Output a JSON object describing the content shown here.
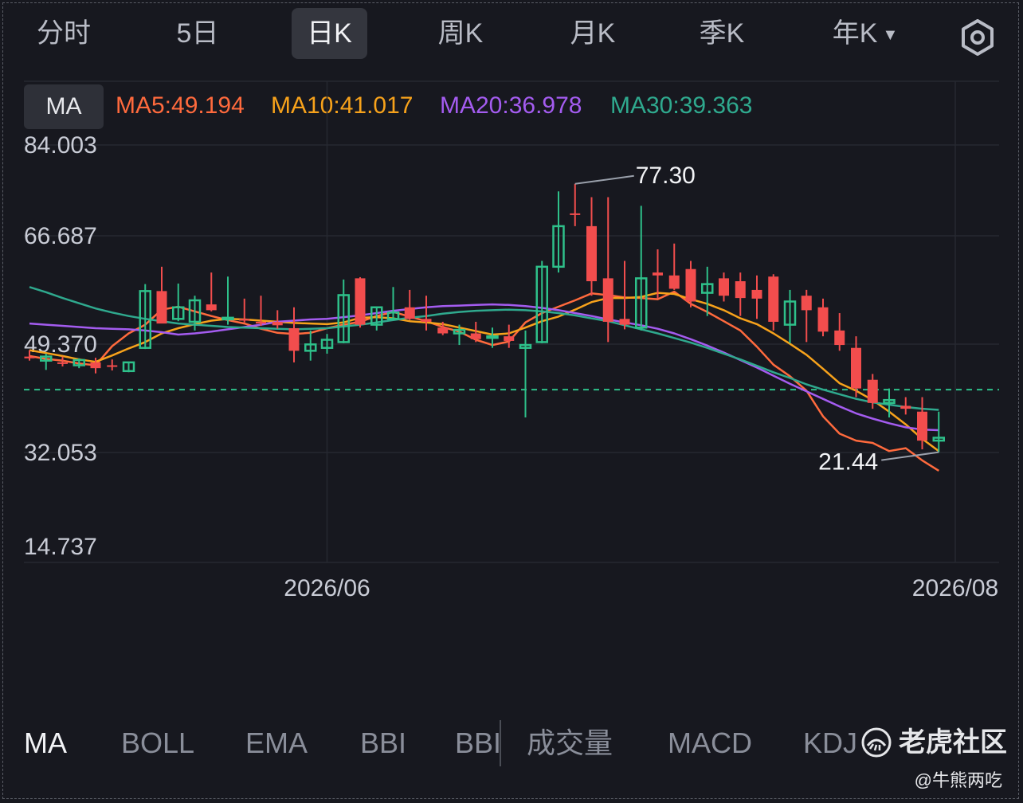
{
  "tabs": [
    {
      "label": "分时",
      "active": false
    },
    {
      "label": "5日",
      "active": false
    },
    {
      "label": "日K",
      "active": true
    },
    {
      "label": "周K",
      "active": false
    },
    {
      "label": "月K",
      "active": false
    },
    {
      "label": "季K",
      "active": false
    },
    {
      "label": "年K",
      "active": false,
      "dropdown": true
    }
  ],
  "ma_bar": {
    "button_label": "MA",
    "items": [
      {
        "label": "MA5:49.194",
        "color": "#ff6a3d"
      },
      {
        "label": "MA10:41.017",
        "color": "#f7a21b"
      },
      {
        "label": "MA20:36.978",
        "color": "#a45cf0"
      },
      {
        "label": "MA30:39.363",
        "color": "#2fa98e"
      }
    ]
  },
  "colors": {
    "up": "#2ec08a",
    "down": "#f24d4d",
    "dashed": "#2ec08a",
    "grid": "#262831",
    "axis_text": "#c9ccd6"
  },
  "chart_data": {
    "type": "candlestick",
    "y_ticks": [
      "84.003",
      "66.687",
      "49.370",
      "32.053",
      "14.737"
    ],
    "ylim": [
      14.737,
      84.003
    ],
    "x_ticks": [
      {
        "label": "2026/06",
        "index": 18
      },
      {
        "label": "2026/08",
        "index": 56
      }
    ],
    "max_label": "77.30",
    "min_label": "21.44",
    "last_price": 41.8,
    "ohlc": [
      [
        47.5,
        48.6,
        46.8,
        47.2
      ],
      [
        46.8,
        48.0,
        45.2,
        47.5
      ],
      [
        46.5,
        47.5,
        45.8,
        46.4
      ],
      [
        46.0,
        47.2,
        45.5,
        46.9
      ],
      [
        46.5,
        47.3,
        44.6,
        45.5
      ],
      [
        46.0,
        47.0,
        45.1,
        45.8
      ],
      [
        45.0,
        46.5,
        44.8,
        46.5
      ],
      [
        49.0,
        60.0,
        48.8,
        58.8
      ],
      [
        58.8,
        63.0,
        54.0,
        53.2
      ],
      [
        54.0,
        60.1,
        53.6,
        56.0
      ],
      [
        53.5,
        58.0,
        52.0,
        57.2
      ],
      [
        56.5,
        62.0,
        55.3,
        55.5
      ],
      [
        54.0,
        61.3,
        53.0,
        54.2
      ],
      [
        54.0,
        57.5,
        53.4,
        53.7
      ],
      [
        53.5,
        58.0,
        52.8,
        53.2
      ],
      [
        53.5,
        55.5,
        52.3,
        52.9
      ],
      [
        52.4,
        56.0,
        46.5,
        48.5
      ],
      [
        48.5,
        52.0,
        46.8,
        49.6
      ],
      [
        49.0,
        51.4,
        48.0,
        50.4
      ],
      [
        50.0,
        60.8,
        49.8,
        58.1
      ],
      [
        61.0,
        61.2,
        52.5,
        53.0
      ],
      [
        53.0,
        56.0,
        52.0,
        56.0
      ],
      [
        54.0,
        59.5,
        53.8,
        55.1
      ],
      [
        56.0,
        59.0,
        53.8,
        54.0
      ],
      [
        54.0,
        58.0,
        52.0,
        53.5
      ],
      [
        52.5,
        53.5,
        51.2,
        51.5
      ],
      [
        51.5,
        53.0,
        49.5,
        52.1
      ],
      [
        51.5,
        53.5,
        50.0,
        50.5
      ],
      [
        51.0,
        52.5,
        49.0,
        51.0
      ],
      [
        51.0,
        53.0,
        49.0,
        50.2
      ],
      [
        49.0,
        52.0,
        37.0,
        49.5
      ],
      [
        50.0,
        64.0,
        49.8,
        63.0
      ],
      [
        63.0,
        76.0,
        62.0,
        70.0
      ],
      [
        72.2,
        77.3,
        70.0,
        72.0
      ],
      [
        70.0,
        75.0,
        58.0,
        60.5
      ],
      [
        61.0,
        75.0,
        50.0,
        53.5
      ],
      [
        54.0,
        64.0,
        52.2,
        53.0
      ],
      [
        52.5,
        73.5,
        52.0,
        61.0
      ],
      [
        62.0,
        66.0,
        57.5,
        61.5
      ],
      [
        61.5,
        67.0,
        59.0,
        59.2
      ],
      [
        62.6,
        64.0,
        56.0,
        57.0
      ],
      [
        58.5,
        63.0,
        54.5,
        60.0
      ],
      [
        61.0,
        62.0,
        57.0,
        58.0
      ],
      [
        60.5,
        62.0,
        54.5,
        57.6
      ],
      [
        59.0,
        61.5,
        54.0,
        57.5
      ],
      [
        61.3,
        61.7,
        52.0,
        53.5
      ],
      [
        53.0,
        59.0,
        49.8,
        57.0
      ],
      [
        58.0,
        59.0,
        50.0,
        55.5
      ],
      [
        56.0,
        57.5,
        51.0,
        51.8
      ],
      [
        52.0,
        55.0,
        48.5,
        49.5
      ],
      [
        49.0,
        51.0,
        40.5,
        42.0
      ],
      [
        43.5,
        44.5,
        38.5,
        39.5
      ],
      [
        39.5,
        42.0,
        37.0,
        40.0
      ],
      [
        39.0,
        40.5,
        37.5,
        38.5
      ],
      [
        38.0,
        40.5,
        31.5,
        33.0
      ],
      [
        33.0,
        38.0,
        31.0,
        33.5
      ]
    ],
    "ma": [
      {
        "name": "MA5",
        "color": "#ff6a3d",
        "values": [
          47.6,
          47.1,
          46.8,
          46.3,
          46.0,
          49.3,
          51.5,
          53.0,
          55.6,
          56.1,
          55.3,
          54.5,
          53.8,
          53.2,
          52.3,
          51.6,
          51.4,
          51.6,
          52.4,
          53.0,
          53.5,
          54.5,
          55.2,
          54.4,
          53.6,
          52.6,
          51.8,
          50.4,
          49.5,
          50.1,
          53.4,
          55.0,
          56.1,
          57.2,
          58.4,
          58.1,
          57.7,
          57.6,
          57.4,
          58.7,
          56.6,
          55.2,
          53.6,
          52.0,
          49.2,
          46.1,
          44.1,
          41.6,
          37.2,
          34.2,
          33.0,
          32.6,
          31.2,
          31.7,
          29.6,
          27.8
        ]
      },
      {
        "name": "MA10",
        "color": "#f7a21b",
        "values": [
          48.6,
          48.1,
          47.6,
          47.0,
          46.6,
          47.7,
          48.9,
          50.0,
          51.5,
          52.4,
          53.1,
          53.7,
          54.0,
          53.9,
          53.7,
          53.5,
          53.3,
          53.2,
          53.1,
          53.4,
          54.2,
          54.3,
          54.1,
          53.6,
          53.4,
          53.1,
          52.5,
          51.9,
          51.3,
          51.5,
          52.5,
          53.6,
          54.4,
          55.6,
          56.9,
          57.6,
          57.6,
          57.8,
          58.5,
          58.3,
          57.4,
          56.6,
          55.5,
          54.1,
          53.1,
          51.5,
          49.7,
          47.8,
          45.4,
          42.9,
          41.6,
          40.0,
          38.0,
          35.8,
          33.3,
          31.2
        ]
      },
      {
        "name": "MA20",
        "color": "#a45cf0",
        "values": [
          53.2,
          53.0,
          52.8,
          52.6,
          52.4,
          52.3,
          52.2,
          52.0,
          51.7,
          51.3,
          51.5,
          51.8,
          52.2,
          52.6,
          53.0,
          53.5,
          53.7,
          53.9,
          54.0,
          54.3,
          54.6,
          55.0,
          55.4,
          55.7,
          56.0,
          56.2,
          56.3,
          56.4,
          56.5,
          56.4,
          56.2,
          55.9,
          55.5,
          55.0,
          54.5,
          53.9,
          53.4,
          52.9,
          52.3,
          51.5,
          50.5,
          49.4,
          48.2,
          46.9,
          45.6,
          44.2,
          42.8,
          41.5,
          40.2,
          38.9,
          37.7,
          36.8,
          36.0,
          35.3,
          34.9,
          34.8
        ]
      },
      {
        "name": "MA30",
        "color": "#2fa98e",
        "values": [
          59.5,
          58.6,
          57.6,
          56.7,
          55.8,
          55.1,
          54.5,
          54.0,
          53.6,
          53.2,
          53.0,
          52.8,
          52.6,
          52.5,
          52.4,
          52.3,
          52.2,
          52.3,
          52.4,
          52.7,
          53.0,
          53.4,
          53.8,
          54.2,
          54.5,
          54.9,
          55.2,
          55.4,
          55.5,
          55.6,
          55.5,
          55.3,
          55.0,
          54.6,
          54.1,
          53.6,
          52.9,
          52.2,
          51.5,
          50.7,
          49.9,
          49.0,
          48.0,
          47.0,
          45.9,
          44.8,
          43.8,
          42.7,
          41.8,
          41.0,
          40.2,
          39.6,
          39.2,
          38.8,
          38.5,
          38.3
        ]
      }
    ]
  },
  "bottom_tabs": [
    {
      "label": "MA",
      "active": true
    },
    {
      "label": "BOLL",
      "active": false
    },
    {
      "label": "EMA",
      "active": false
    },
    {
      "label": "BBI",
      "active": false
    },
    {
      "label": "BBI",
      "active": false
    },
    {
      "label": "成交量",
      "active": false
    },
    {
      "label": "MACD",
      "active": false
    },
    {
      "label": "KDJ",
      "active": false
    }
  ],
  "watermark": {
    "text": "老虎社区",
    "handle": "@牛熊两吃"
  }
}
